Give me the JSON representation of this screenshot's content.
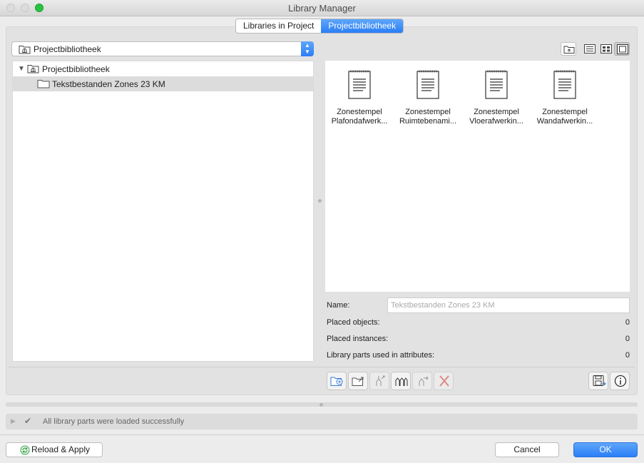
{
  "window": {
    "title": "Library Manager"
  },
  "tabs": [
    {
      "label": "Libraries in Project",
      "active": false
    },
    {
      "label": "Projectbibliotheek",
      "active": true
    }
  ],
  "library_popup": {
    "value": "Projectbibliotheek"
  },
  "tree": {
    "root": {
      "label": "Projectbibliotheek",
      "expanded": true
    },
    "children": [
      {
        "label": "Tekstbestanden Zones 23 KM",
        "selected": true
      }
    ]
  },
  "gallery": {
    "items": [
      {
        "line1": "Zonestempel",
        "line2": "Plafondafwerk..."
      },
      {
        "line1": "Zonestempel",
        "line2": "Ruimtebenami..."
      },
      {
        "line1": "Zonestempel",
        "line2": "Vloerafwerkin..."
      },
      {
        "line1": "Zonestempel",
        "line2": "Wandafwerkin..."
      }
    ]
  },
  "info": {
    "name_label": "Name:",
    "name_placeholder": "Tekstbestanden Zones 23 KM",
    "placed_objects_label": "Placed objects:",
    "placed_objects_value": "0",
    "placed_instances_label": "Placed instances:",
    "placed_instances_value": "0",
    "attributes_label": "Library parts used in attributes:",
    "attributes_value": "0"
  },
  "status": {
    "message": "All library parts were loaded successfully"
  },
  "buttons": {
    "reload": "Reload & Apply",
    "cancel": "Cancel",
    "ok": "OK"
  },
  "colors": {
    "accent": "#2b7ef6",
    "window_bg": "#ececec",
    "success_green": "#2ac33f"
  }
}
